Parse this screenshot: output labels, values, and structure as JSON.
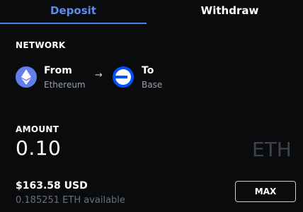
{
  "tabs": {
    "deposit": "Deposit",
    "withdraw": "Withdraw",
    "active": "Deposit"
  },
  "network": {
    "label": "NETWORK",
    "from_label": "From",
    "from_network": "Ethereum",
    "from_icon": "ethereum-icon",
    "to_label": "To",
    "to_network": "Base",
    "to_icon": "base-icon",
    "arrow": "→"
  },
  "amount": {
    "label": "AMOUNT",
    "value": "0.10",
    "unit": "ETH",
    "usd_value": "$163.58 USD",
    "available": "0.185251 ETH available",
    "max_label": "MAX"
  },
  "colors": {
    "background": "#0a0b0d",
    "accent": "#4c7ff0",
    "ethereum": "#627eea",
    "base": "#0052ff"
  }
}
